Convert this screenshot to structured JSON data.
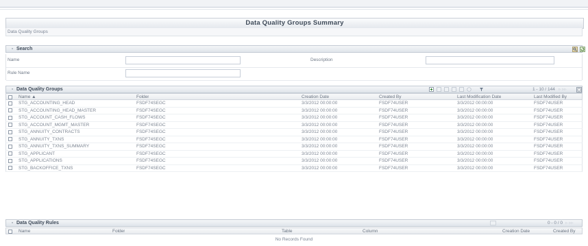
{
  "page": {
    "title": "Data Quality Groups Summary",
    "breadcrumb": "Data Quality Groups"
  },
  "search": {
    "header": "Search",
    "fields": {
      "name_label": "Name",
      "description_label": "Description",
      "rule_name_label": "Rule Name"
    }
  },
  "groups": {
    "header": "Data Quality Groups",
    "pager": "1 - 10 / 144",
    "columns": [
      "Name",
      "Folder",
      "Creation Date",
      "Created By",
      "Last Modification Date",
      "Last Modified By"
    ],
    "rows": [
      [
        "STG_ACCOUNTING_HEAD",
        "FSDF74SEGC",
        "3/3/2012 00:00:00",
        "FSDF74USER",
        "3/3/2012 00:00:00",
        "FSDF74USER"
      ],
      [
        "STG_ACCOUNTING_HEAD_MASTER",
        "FSDF74SEGC",
        "3/3/2012 00:00:00",
        "FSDF74USER",
        "3/3/2012 00:00:00",
        "FSDF74USER"
      ],
      [
        "STG_ACCOUNT_CASH_FLOWS",
        "FSDF74SEGC",
        "3/3/2012 00:00:00",
        "FSDF74USER",
        "3/3/2012 00:00:00",
        "FSDF74USER"
      ],
      [
        "STG_ACCOUNT_MGMT_MASTER",
        "FSDF74SEGC",
        "3/3/2012 00:00:00",
        "FSDF74USER",
        "3/3/2012 00:00:00",
        "FSDF74USER"
      ],
      [
        "STG_ANNUITY_CONTRACTS",
        "FSDF74SEGC",
        "3/3/2012 00:00:00",
        "FSDF74USER",
        "3/3/2012 00:00:00",
        "FSDF74USER"
      ],
      [
        "STG_ANNUITY_TXNS",
        "FSDF74SEGC",
        "3/3/2012 00:00:00",
        "FSDF74USER",
        "3/3/2012 00:00:00",
        "FSDF74USER"
      ],
      [
        "STG_ANNUITY_TXNS_SUMMARY",
        "FSDF74SEGC",
        "3/3/2012 00:00:00",
        "FSDF74USER",
        "3/3/2012 00:00:00",
        "FSDF74USER"
      ],
      [
        "STG_APPLICANT",
        "FSDF74SEGC",
        "3/3/2012 00:00:00",
        "FSDF74USER",
        "3/3/2012 00:00:00",
        "FSDF74USER"
      ],
      [
        "STG_APPLICATIONS",
        "FSDF74SEGC",
        "3/3/2012 00:00:00",
        "FSDF74USER",
        "3/3/2012 00:00:00",
        "FSDF74USER"
      ],
      [
        "STG_BACKOFFICE_TXNS",
        "FSDF74SEGC",
        "3/3/2012 00:00:00",
        "FSDF74USER",
        "3/3/2012 00:00:00",
        "FSDF74USER"
      ]
    ]
  },
  "rules": {
    "header": "Data Quality Rules",
    "pager": "0 - 0 / 0",
    "columns": [
      "Name",
      "Folder",
      "Table",
      "Column",
      "Creation Date",
      "Created By"
    ],
    "empty_text": "No Records Found"
  },
  "icons": {
    "search_go": "search-go-icon",
    "reset": "reset-icon",
    "add": "add-icon",
    "view": "view-icon",
    "edit": "edit-icon",
    "copy": "copy-icon",
    "delete": "delete-icon",
    "run": "run-icon",
    "filter": "filter-icon"
  },
  "colors": {
    "header_text": "#3e4a59",
    "border": "#c3cad3"
  }
}
